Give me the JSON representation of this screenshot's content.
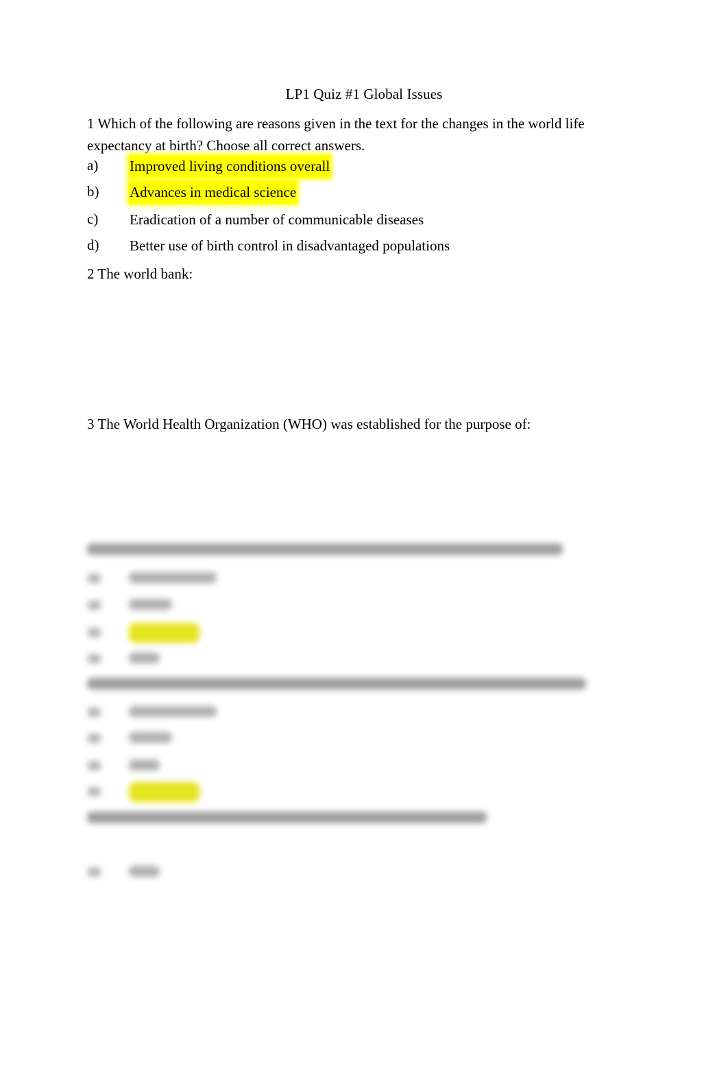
{
  "document": {
    "title": "LP1 Quiz #1 Global Issues",
    "background_color": "#ffffff",
    "text_color": "#000000",
    "highlight_color": "#ffff00"
  },
  "questions": [
    {
      "number": "1",
      "prompt": "1 Which of the following are reasons given in the text for the changes in the world life expectancy at birth? Choose all correct answers.",
      "legible": true,
      "options": [
        {
          "marker": "a)",
          "text": "Improved living conditions overall",
          "highlighted": true
        },
        {
          "marker": "b)",
          "text": "Advances in medical science",
          "highlighted": true
        },
        {
          "marker": "c)",
          "text": "Eradication of a number of communicable diseases",
          "highlighted": false
        },
        {
          "marker": "d)",
          "text": "Better use of birth control in disadvantaged populations",
          "highlighted": false
        }
      ]
    },
    {
      "number": "2",
      "prompt": "2 The world bank:",
      "legible": true,
      "options": []
    },
    {
      "number": "3",
      "prompt": "3 The World Health Organization (WHO) was established for the purpose of:",
      "legible": true,
      "options": []
    },
    {
      "number": "4",
      "prompt": "",
      "legible": false,
      "redacted_label": "blurred question line",
      "options": [
        {
          "marker": "",
          "text": "",
          "highlighted": false,
          "redacted_label": "blurred option"
        },
        {
          "marker": "",
          "text": "",
          "highlighted": false,
          "redacted_label": "blurred option"
        },
        {
          "marker": "",
          "text": "",
          "highlighted": true,
          "redacted_label": "blurred highlighted option"
        },
        {
          "marker": "",
          "text": "",
          "highlighted": false,
          "redacted_label": "blurred option"
        }
      ]
    },
    {
      "number": "5",
      "prompt": "",
      "legible": false,
      "redacted_label": "blurred question line",
      "options": [
        {
          "marker": "",
          "text": "",
          "highlighted": false,
          "redacted_label": "blurred option"
        },
        {
          "marker": "",
          "text": "",
          "highlighted": false,
          "redacted_label": "blurred option"
        },
        {
          "marker": "",
          "text": "",
          "highlighted": false,
          "redacted_label": "blurred option"
        },
        {
          "marker": "",
          "text": "",
          "highlighted": true,
          "redacted_label": "blurred highlighted option"
        }
      ]
    },
    {
      "number": "6",
      "prompt": "",
      "legible": false,
      "redacted_label": "blurred question line",
      "options": [
        {
          "marker": "",
          "text": "",
          "highlighted": false,
          "redacted_label": "blurred option"
        }
      ]
    }
  ]
}
